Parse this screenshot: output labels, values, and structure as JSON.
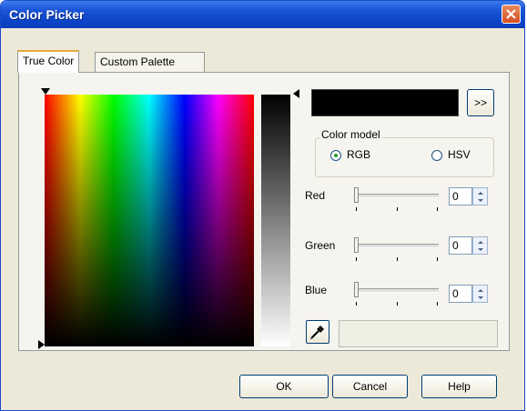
{
  "window": {
    "title": "Color Picker"
  },
  "tabs": [
    {
      "label": "True Color",
      "active": true
    },
    {
      "label": "Custom Palette",
      "active": false
    }
  ],
  "preview": {
    "color": "#000000",
    "more_label": ">>"
  },
  "color_model": {
    "label": "Color model",
    "options": [
      {
        "label": "RGB",
        "checked": true
      },
      {
        "label": "HSV",
        "checked": false
      }
    ]
  },
  "channels": [
    {
      "label": "Red",
      "value": "0"
    },
    {
      "label": "Green",
      "value": "0"
    },
    {
      "label": "Blue",
      "value": "0"
    }
  ],
  "buttons": {
    "ok": "OK",
    "cancel": "Cancel",
    "help": "Help"
  },
  "icons": {
    "close": "close-icon",
    "eyedropper": "eyedropper-icon"
  }
}
